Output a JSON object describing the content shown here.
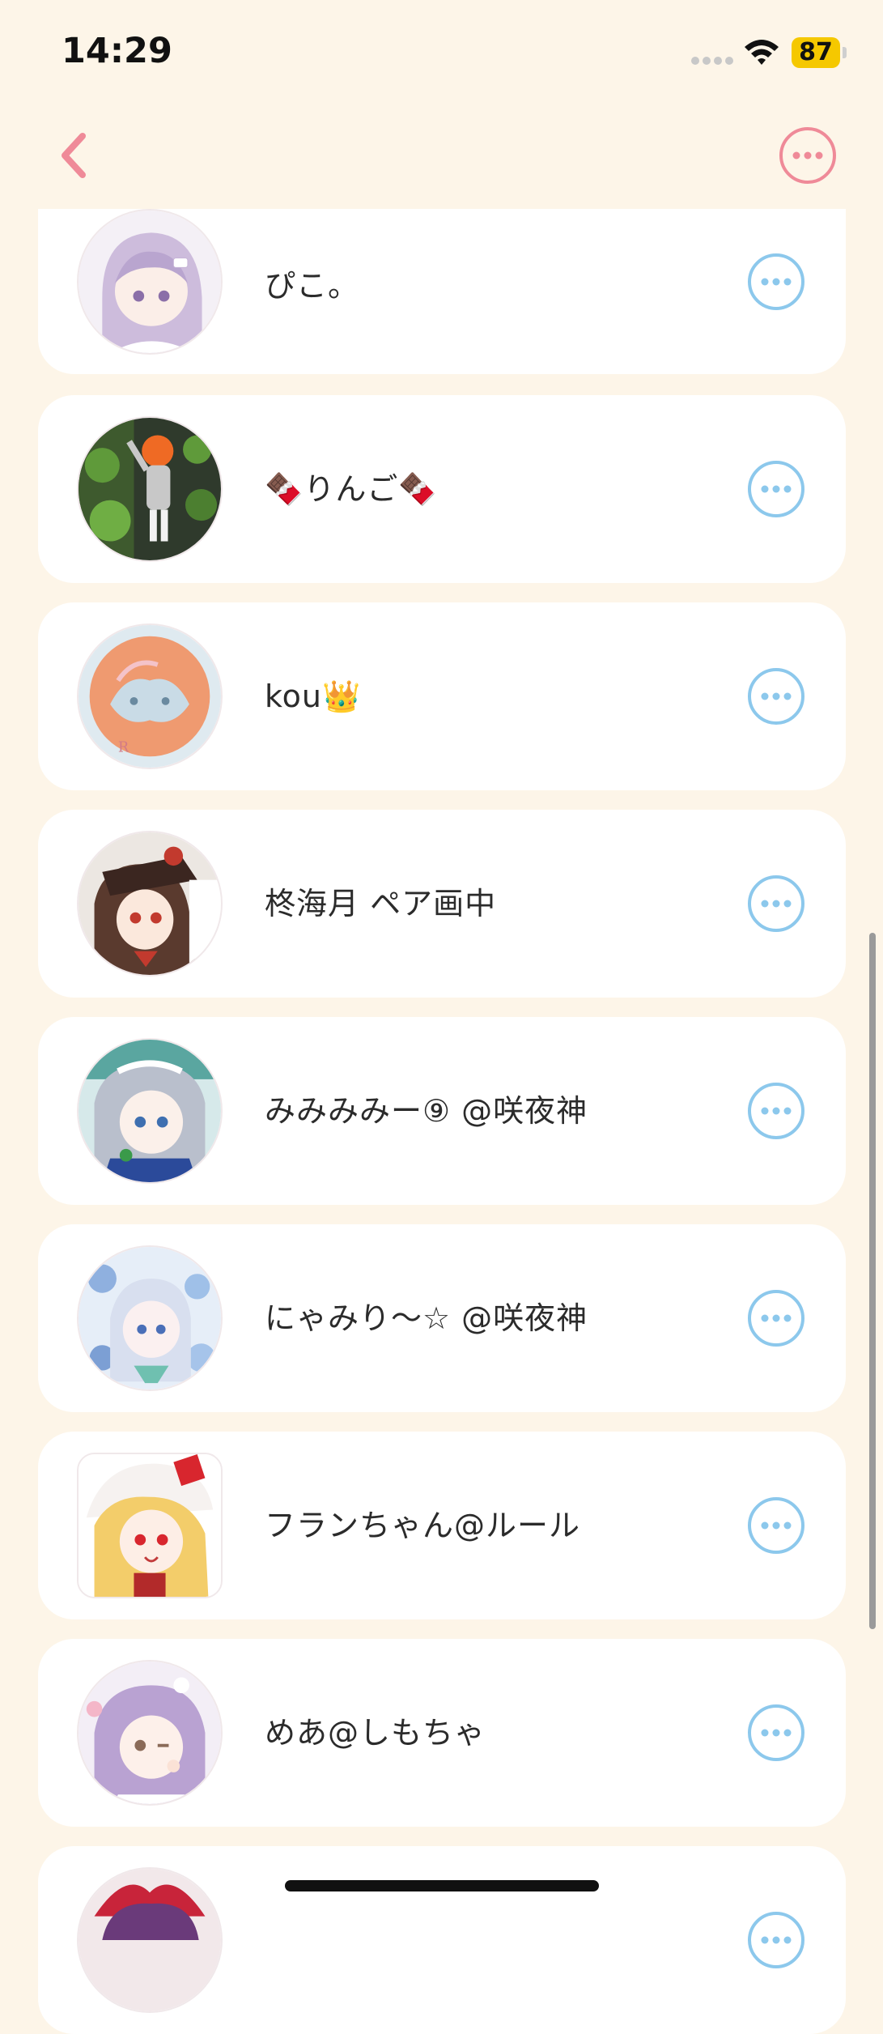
{
  "status_bar": {
    "time": "14:29",
    "battery": "87",
    "battery_color": "#f5c800"
  },
  "nav": {
    "back_icon": "chevron-left-icon",
    "more_icon": "ellipsis-circle-icon",
    "accent_color": "#ef8a98"
  },
  "list": {
    "more_icon": "ellipsis-circle-icon",
    "more_color": "#8cc8ec",
    "items": [
      {
        "name": "ぴこ。",
        "avatar": "lavender-hair-anime-girl"
      },
      {
        "name": "🍫りんご🍫",
        "avatar": "orange-hair-character-in-greenery"
      },
      {
        "name": "kou👑",
        "avatar": "orange-sketch-characters"
      },
      {
        "name": "柊海月 ペア画中",
        "avatar": "brown-hair-girl-with-hat"
      },
      {
        "name": "みみみみー⑨ @咲夜神",
        "avatar": "silver-hair-maid"
      },
      {
        "name": "にゃみり〜☆ @咲夜神",
        "avatar": "blue-floral-maid"
      },
      {
        "name": "フランちゃん@ルール",
        "avatar": "blonde-girl-red-bow"
      },
      {
        "name": "めあ@しもちゃ",
        "avatar": "purple-hair-winking-girl"
      },
      {
        "name": "",
        "avatar": "red-bow-girl-partial"
      }
    ]
  }
}
